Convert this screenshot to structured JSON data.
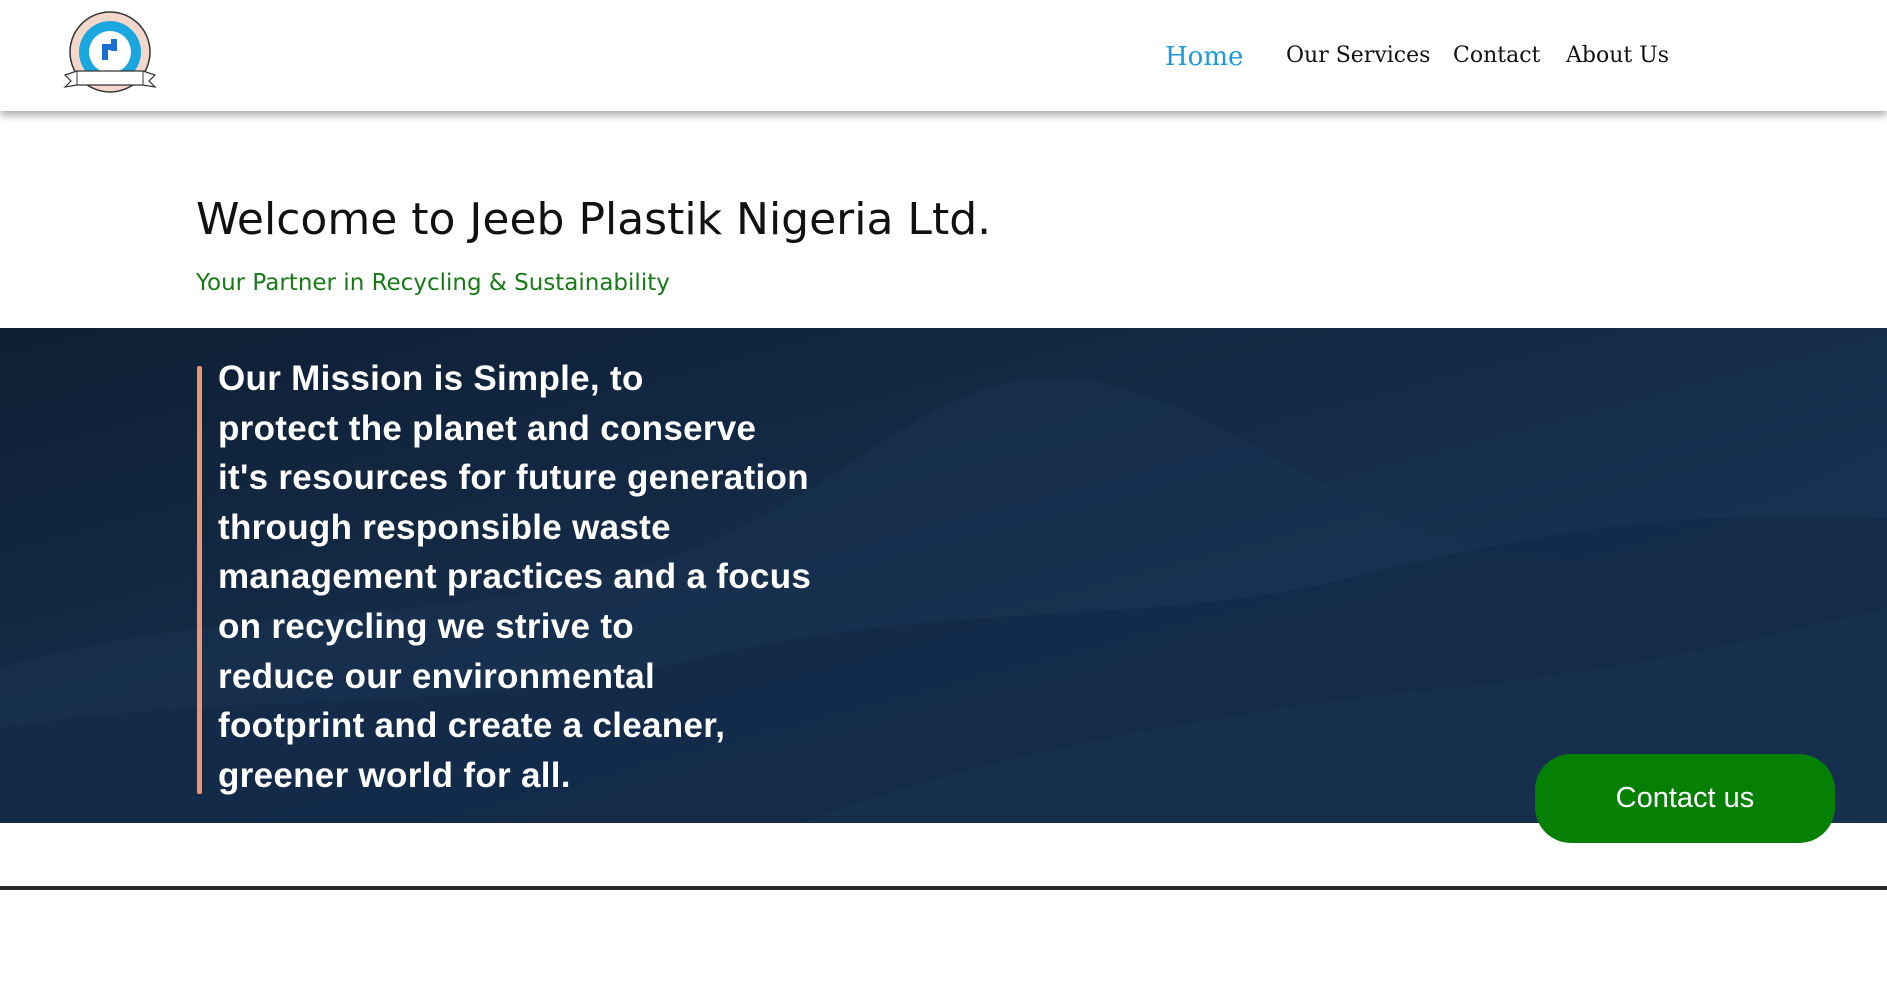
{
  "header": {
    "logo_icon": "jeeb-plastik-logo-icon",
    "nav": [
      {
        "label": "Home",
        "active": true
      },
      {
        "label": "Our Services",
        "active": false
      },
      {
        "label": "Contact",
        "active": false
      },
      {
        "label": "About Us",
        "active": false
      }
    ]
  },
  "welcome": {
    "title": "Welcome to Jeeb Plastik Nigeria Ltd.",
    "subtitle": "Your Partner in Recycling & Sustainability"
  },
  "mission": {
    "lines": [
      "Our Mission is Simple, to",
      "protect the planet and conserve",
      "it's resources for future generation",
      "through responsible waste",
      "management practices and a focus",
      "on recycling we strive to",
      "reduce our environmental",
      "footprint and create a cleaner,",
      "greener world for all."
    ]
  },
  "cta": {
    "label": "Contact us"
  },
  "colors": {
    "nav_active": "#1a9bd7",
    "subtitle_green": "#177a17",
    "hero_bg": "#142741",
    "mission_accent": "#e9956e",
    "button_green": "#058005"
  }
}
